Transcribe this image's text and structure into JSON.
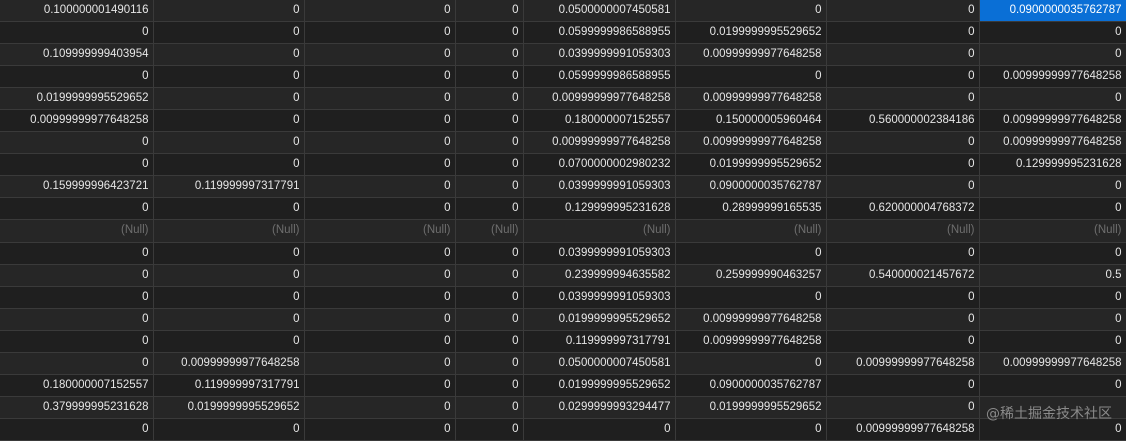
{
  "rows": [
    [
      "0.100000001490116",
      "0",
      "0",
      "0",
      "0.0500000007450581",
      "0",
      "0",
      "0.0900000035762787"
    ],
    [
      "0",
      "0",
      "0",
      "0",
      "0.0599999986588955",
      "0.0199999995529652",
      "0",
      "0"
    ],
    [
      "0.109999999403954",
      "0",
      "0",
      "0",
      "0.0399999991059303",
      "0.00999999977648258",
      "0",
      "0"
    ],
    [
      "0",
      "0",
      "0",
      "0",
      "0.0599999986588955",
      "0",
      "0",
      "0.00999999977648258"
    ],
    [
      "0.0199999995529652",
      "0",
      "0",
      "0",
      "0.00999999977648258",
      "0.00999999977648258",
      "0",
      "0"
    ],
    [
      "0.00999999977648258",
      "0",
      "0",
      "0",
      "0.180000007152557",
      "0.150000005960464",
      "0.560000002384186",
      "0.00999999977648258"
    ],
    [
      "0",
      "0",
      "0",
      "0",
      "0.00999999977648258",
      "0.00999999977648258",
      "0",
      "0.00999999977648258"
    ],
    [
      "0",
      "0",
      "0",
      "0",
      "0.0700000002980232",
      "0.0199999995529652",
      "0",
      "0.129999995231628"
    ],
    [
      "0.159999996423721",
      "0.119999997317791",
      "0",
      "0",
      "0.0399999991059303",
      "0.0900000035762787",
      "0",
      "0"
    ],
    [
      "0",
      "0",
      "0",
      "0",
      "0.129999995231628",
      "0.28999999165535",
      "0.620000004768372",
      "0"
    ],
    [
      "(Null)",
      "(Null)",
      "(Null)",
      "(Null)",
      "(Null)",
      "(Null)",
      "(Null)",
      "(Null)"
    ],
    [
      "0",
      "0",
      "0",
      "0",
      "0.0399999991059303",
      "0",
      "0",
      "0"
    ],
    [
      "0",
      "0",
      "0",
      "0",
      "0.239999994635582",
      "0.259999990463257",
      "0.540000021457672",
      "0.5"
    ],
    [
      "0",
      "0",
      "0",
      "0",
      "0.0399999991059303",
      "0",
      "0",
      "0"
    ],
    [
      "0",
      "0",
      "0",
      "0",
      "0.0199999995529652",
      "0.00999999977648258",
      "0",
      "0"
    ],
    [
      "0",
      "0",
      "0",
      "0",
      "0.119999997317791",
      "0.00999999977648258",
      "0",
      "0"
    ],
    [
      "0",
      "0.00999999977648258",
      "0",
      "0",
      "0.0500000007450581",
      "0",
      "0.00999999977648258",
      "0.00999999977648258"
    ],
    [
      "0.180000007152557",
      "0.119999997317791",
      "0",
      "0",
      "0.0199999995529652",
      "0.0900000035762787",
      "0",
      "0"
    ],
    [
      "0.379999995231628",
      "0.0199999995529652",
      "0",
      "0",
      "0.0299999993294477",
      "0.0199999995529652",
      "0",
      ""
    ],
    [
      "0",
      "0",
      "0",
      "0",
      "0",
      "0",
      "0.00999999977648258",
      "0"
    ]
  ],
  "selected_cell": {
    "row": 0,
    "col": 7
  },
  "null_token": "(Null)",
  "watermark": "@稀土掘金技术社区",
  "colors": {
    "background": "#1e1e1e",
    "selection": "#0a6fd6",
    "null_text": "#6e6e6e",
    "cell_text": "#e6e6e6"
  }
}
